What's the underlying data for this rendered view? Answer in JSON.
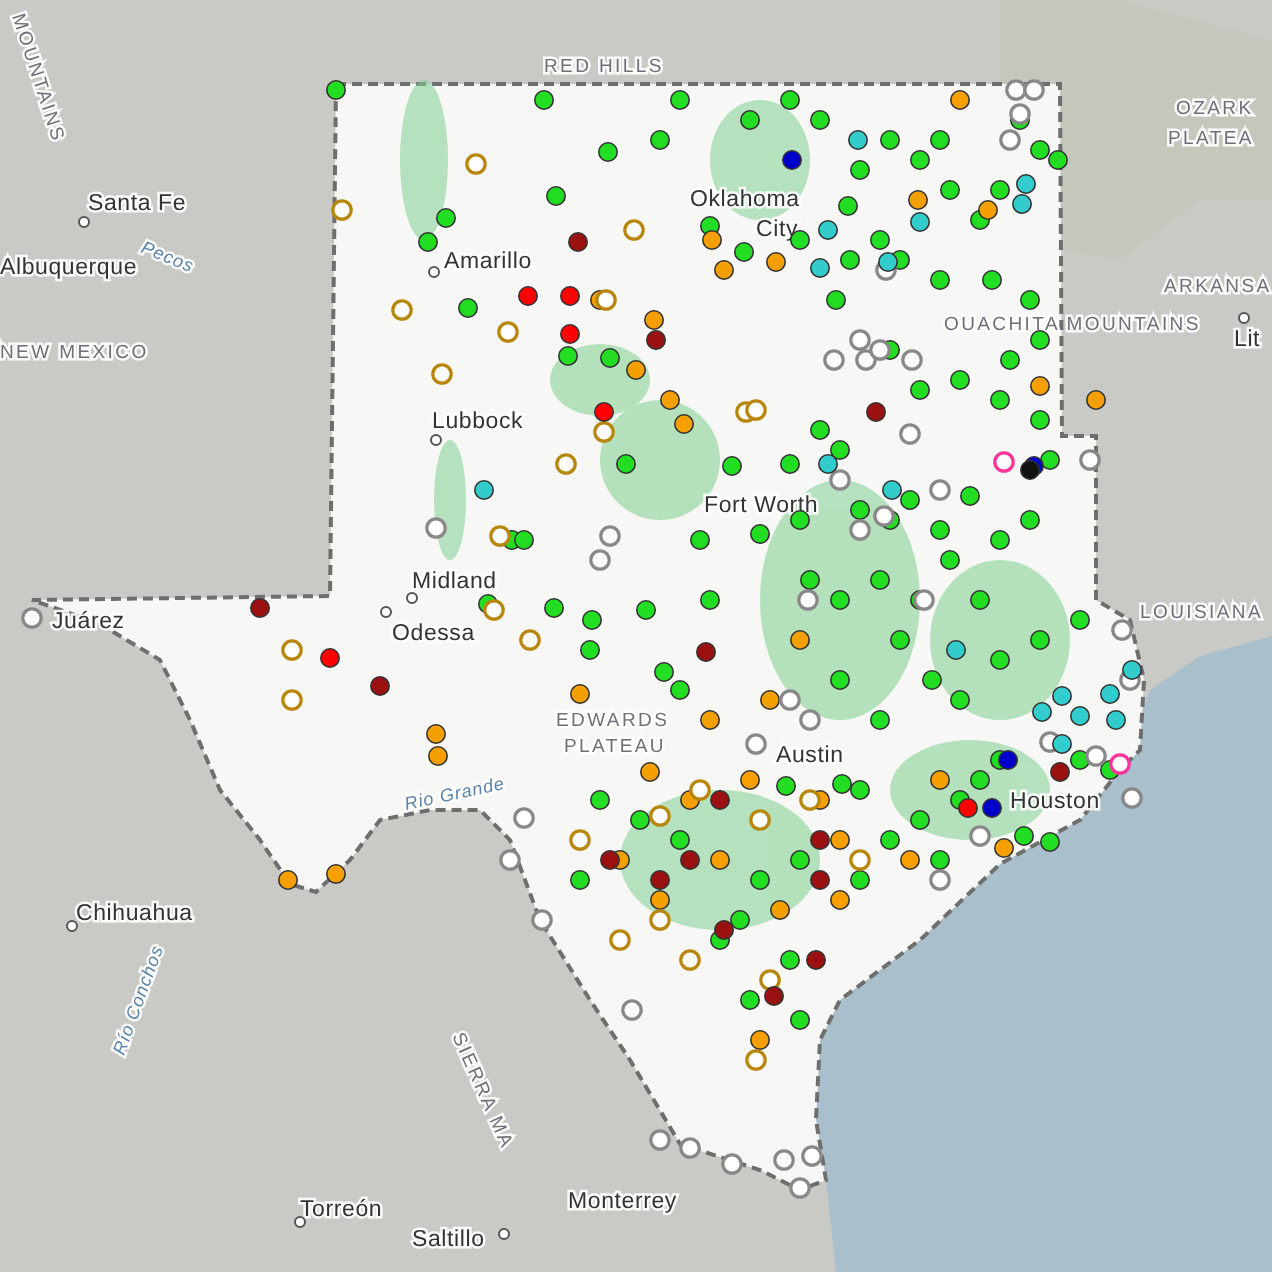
{
  "labels": [
    {
      "text": "MOUNTAINS",
      "kind": "region"
    },
    {
      "text": "RED HILLS",
      "kind": "region"
    },
    {
      "text": "OZARK",
      "kind": "region"
    },
    {
      "text": "PLATEA",
      "kind": "region"
    },
    {
      "text": "ARKANSA",
      "kind": "region"
    },
    {
      "text": "Lit",
      "kind": "city"
    },
    {
      "text": "OUACHITA MOUNTAINS",
      "kind": "region"
    },
    {
      "text": "LOUISIANA",
      "kind": "region"
    },
    {
      "text": "Santa Fe",
      "kind": "city"
    },
    {
      "text": "Albuquerque",
      "kind": "city"
    },
    {
      "text": "NEW MEXICO",
      "kind": "region"
    },
    {
      "text": "Amarillo",
      "kind": "city"
    },
    {
      "text": "Lubbock",
      "kind": "city"
    },
    {
      "text": "Midland",
      "kind": "city"
    },
    {
      "text": "Odessa",
      "kind": "city"
    },
    {
      "text": "Juárez",
      "kind": "city"
    },
    {
      "text": "Chihuahua",
      "kind": "city"
    },
    {
      "text": "Torreón",
      "kind": "city"
    },
    {
      "text": "Saltillo",
      "kind": "city"
    },
    {
      "text": "Monterrey",
      "kind": "city"
    },
    {
      "text": "SIERRA MA",
      "kind": "region"
    },
    {
      "text": "Oklahoma",
      "kind": "city"
    },
    {
      "text": "City",
      "kind": "text"
    },
    {
      "text": "Fort Worth",
      "kind": "city"
    },
    {
      "text": "Austin",
      "kind": "city"
    },
    {
      "text": "Houston",
      "kind": "city"
    },
    {
      "text": "EDWARDS",
      "kind": "region"
    },
    {
      "text": "PLATEAU",
      "kind": "region"
    },
    {
      "text": "Rio Grande",
      "kind": "water"
    },
    {
      "text": "Pecos",
      "kind": "water"
    },
    {
      "text": "Río Conchos",
      "kind": "water"
    }
  ],
  "markers": [
    {
      "kind": "filled",
      "color": "#22dd22"
    },
    {
      "kind": "filled",
      "color": "#22dd22"
    },
    {
      "kind": "filled",
      "color": "#22dd22"
    },
    {
      "kind": "filled",
      "color": "#22dd22"
    },
    {
      "kind": "filled",
      "color": "#22dd22"
    },
    {
      "kind": "filled",
      "color": "#22dd22"
    },
    {
      "kind": "filled",
      "color": "#22dd22"
    },
    {
      "kind": "filled",
      "color": "#22dd22"
    },
    {
      "kind": "filled",
      "color": "#22dd22"
    },
    {
      "kind": "filled",
      "color": "#22dd22"
    },
    {
      "kind": "filled",
      "color": "#22dd22"
    },
    {
      "kind": "filled",
      "color": "#22dd22"
    },
    {
      "kind": "filled",
      "color": "#22dd22"
    },
    {
      "kind": "filled",
      "color": "#22dd22"
    },
    {
      "kind": "filled",
      "color": "#22dd22"
    },
    {
      "kind": "filled",
      "color": "#22dd22"
    },
    {
      "kind": "filled",
      "color": "#22dd22"
    },
    {
      "kind": "filled",
      "color": "#22dd22"
    },
    {
      "kind": "filled",
      "color": "#22dd22"
    },
    {
      "kind": "filled",
      "color": "#22dd22"
    },
    {
      "kind": "filled",
      "color": "#22dd22"
    },
    {
      "kind": "filled",
      "color": "#22dd22"
    },
    {
      "kind": "filled",
      "color": "#22dd22"
    },
    {
      "kind": "filled",
      "color": "#22dd22"
    },
    {
      "kind": "filled",
      "color": "#22dd22"
    },
    {
      "kind": "filled",
      "color": "#22dd22"
    },
    {
      "kind": "filled",
      "color": "#22dd22"
    },
    {
      "kind": "filled",
      "color": "#22dd22"
    },
    {
      "kind": "filled",
      "color": "#22dd22"
    },
    {
      "kind": "filled",
      "color": "#22dd22"
    },
    {
      "kind": "filled",
      "color": "#22dd22"
    },
    {
      "kind": "filled",
      "color": "#22dd22"
    },
    {
      "kind": "filled",
      "color": "#22dd22"
    },
    {
      "kind": "filled",
      "color": "#22dd22"
    },
    {
      "kind": "filled",
      "color": "#22dd22"
    },
    {
      "kind": "filled",
      "color": "#22dd22"
    },
    {
      "kind": "filled",
      "color": "#22dd22"
    },
    {
      "kind": "filled",
      "color": "#22dd22"
    },
    {
      "kind": "filled",
      "color": "#22dd22"
    },
    {
      "kind": "filled",
      "color": "#22dd22"
    },
    {
      "kind": "filled",
      "color": "#22dd22"
    },
    {
      "kind": "filled",
      "color": "#22dd22"
    },
    {
      "kind": "filled",
      "color": "#22dd22"
    },
    {
      "kind": "filled",
      "color": "#22dd22"
    },
    {
      "kind": "filled",
      "color": "#22dd22"
    },
    {
      "kind": "filled",
      "color": "#22dd22"
    },
    {
      "kind": "filled",
      "color": "#22dd22"
    },
    {
      "kind": "filled",
      "color": "#22dd22"
    },
    {
      "kind": "filled",
      "color": "#22dd22"
    },
    {
      "kind": "filled",
      "color": "#22dd22"
    },
    {
      "kind": "filled",
      "color": "#22dd22"
    },
    {
      "kind": "filled",
      "color": "#22dd22"
    },
    {
      "kind": "filled",
      "color": "#22dd22"
    },
    {
      "kind": "filled",
      "color": "#22dd22"
    },
    {
      "kind": "filled",
      "color": "#22dd22"
    },
    {
      "kind": "filled",
      "color": "#22dd22"
    },
    {
      "kind": "filled",
      "color": "#22dd22"
    },
    {
      "kind": "filled",
      "color": "#22dd22"
    },
    {
      "kind": "filled",
      "color": "#22dd22"
    },
    {
      "kind": "filled",
      "color": "#22dd22"
    },
    {
      "kind": "filled",
      "color": "#22dd22"
    },
    {
      "kind": "filled",
      "color": "#22dd22"
    },
    {
      "kind": "filled",
      "color": "#22dd22"
    },
    {
      "kind": "filled",
      "color": "#22dd22"
    },
    {
      "kind": "filled",
      "color": "#22dd22"
    },
    {
      "kind": "filled",
      "color": "#22dd22"
    },
    {
      "kind": "filled",
      "color": "#22dd22"
    },
    {
      "kind": "filled",
      "color": "#22dd22"
    },
    {
      "kind": "filled",
      "color": "#22dd22"
    },
    {
      "kind": "filled",
      "color": "#22dd22"
    },
    {
      "kind": "filled",
      "color": "#22dd22"
    },
    {
      "kind": "filled",
      "color": "#22dd22"
    },
    {
      "kind": "filled",
      "color": "#22dd22"
    },
    {
      "kind": "filled",
      "color": "#22dd22"
    },
    {
      "kind": "filled",
      "color": "#22dd22"
    },
    {
      "kind": "filled",
      "color": "#22dd22"
    },
    {
      "kind": "filled",
      "color": "#22dd22"
    },
    {
      "kind": "filled",
      "color": "#22dd22"
    },
    {
      "kind": "filled",
      "color": "#22dd22"
    },
    {
      "kind": "filled",
      "color": "#22dd22"
    },
    {
      "kind": "filled",
      "color": "#22dd22"
    },
    {
      "kind": "filled",
      "color": "#22dd22"
    },
    {
      "kind": "filled",
      "color": "#22dd22"
    },
    {
      "kind": "filled",
      "color": "#22dd22"
    },
    {
      "kind": "filled",
      "color": "#22dd22"
    },
    {
      "kind": "filled",
      "color": "#22dd22"
    },
    {
      "kind": "filled",
      "color": "#22dd22"
    },
    {
      "kind": "filled",
      "color": "#22dd22"
    },
    {
      "kind": "filled",
      "color": "#22dd22"
    },
    {
      "kind": "filled",
      "color": "#22dd22"
    },
    {
      "kind": "filled",
      "color": "#22dd22"
    },
    {
      "kind": "filled",
      "color": "#22dd22"
    },
    {
      "kind": "filled",
      "color": "#22dd22"
    },
    {
      "kind": "filled",
      "color": "#22dd22"
    },
    {
      "kind": "filled",
      "color": "#22dd22"
    },
    {
      "kind": "filled",
      "color": "#22dd22"
    },
    {
      "kind": "filled",
      "color": "#22dd22"
    },
    {
      "kind": "filled",
      "color": "#22dd22"
    },
    {
      "kind": "filled",
      "color": "#22dd22"
    },
    {
      "kind": "filled",
      "color": "#22dd22"
    },
    {
      "kind": "filled",
      "color": "#22dd22"
    },
    {
      "kind": "filled",
      "color": "#22dd22"
    },
    {
      "kind": "filled",
      "color": "#22dd22"
    },
    {
      "kind": "filled",
      "color": "#22dd22"
    },
    {
      "kind": "filled",
      "color": "#22dd22"
    },
    {
      "kind": "filled",
      "color": "#22dd22"
    },
    {
      "kind": "filled",
      "color": "#22dd22"
    },
    {
      "kind": "filled",
      "color": "#f5a000"
    },
    {
      "kind": "filled",
      "color": "#f5a000"
    },
    {
      "kind": "filled",
      "color": "#f5a000"
    },
    {
      "kind": "filled",
      "color": "#f5a000"
    },
    {
      "kind": "filled",
      "color": "#f5a000"
    },
    {
      "kind": "filled",
      "color": "#f5a000"
    },
    {
      "kind": "filled",
      "color": "#f5a000"
    },
    {
      "kind": "filled",
      "color": "#f5a000"
    },
    {
      "kind": "filled",
      "color": "#f5a000"
    },
    {
      "kind": "filled",
      "color": "#f5a000"
    },
    {
      "kind": "filled",
      "color": "#f5a000"
    },
    {
      "kind": "filled",
      "color": "#f5a000"
    },
    {
      "kind": "filled",
      "color": "#f5a000"
    },
    {
      "kind": "filled",
      "color": "#f5a000"
    },
    {
      "kind": "filled",
      "color": "#f5a000"
    },
    {
      "kind": "filled",
      "color": "#f5a000"
    },
    {
      "kind": "filled",
      "color": "#f5a000"
    },
    {
      "kind": "filled",
      "color": "#f5a000"
    },
    {
      "kind": "filled",
      "color": "#f5a000"
    },
    {
      "kind": "filled",
      "color": "#f5a000"
    },
    {
      "kind": "filled",
      "color": "#f5a000"
    },
    {
      "kind": "filled",
      "color": "#f5a000"
    },
    {
      "kind": "filled",
      "color": "#f5a000"
    },
    {
      "kind": "filled",
      "color": "#f5a000"
    },
    {
      "kind": "filled",
      "color": "#f5a000"
    },
    {
      "kind": "filled",
      "color": "#f5a000"
    },
    {
      "kind": "filled",
      "color": "#f5a000"
    },
    {
      "kind": "filled",
      "color": "#f5a000"
    },
    {
      "kind": "filled",
      "color": "#f5a000"
    },
    {
      "kind": "filled",
      "color": "#f5a000"
    },
    {
      "kind": "filled",
      "color": "#f5a000"
    },
    {
      "kind": "filled",
      "color": "#f5a000"
    },
    {
      "kind": "filled",
      "color": "#f5a000"
    },
    {
      "kind": "filled",
      "color": "#f5a000"
    },
    {
      "kind": "filled",
      "color": "#f5a000"
    },
    {
      "kind": "ring",
      "color": "#b8860b"
    },
    {
      "kind": "ring",
      "color": "#b8860b"
    },
    {
      "kind": "ring",
      "color": "#b8860b"
    },
    {
      "kind": "ring",
      "color": "#b8860b"
    },
    {
      "kind": "ring",
      "color": "#b8860b"
    },
    {
      "kind": "ring",
      "color": "#b8860b"
    },
    {
      "kind": "ring",
      "color": "#b8860b"
    },
    {
      "kind": "ring",
      "color": "#b8860b"
    },
    {
      "kind": "ring",
      "color": "#b8860b"
    },
    {
      "kind": "ring",
      "color": "#b8860b"
    },
    {
      "kind": "ring",
      "color": "#b8860b"
    },
    {
      "kind": "ring",
      "color": "#b8860b"
    },
    {
      "kind": "ring",
      "color": "#b8860b"
    },
    {
      "kind": "ring",
      "color": "#b8860b"
    },
    {
      "kind": "ring",
      "color": "#b8860b"
    },
    {
      "kind": "ring",
      "color": "#b8860b"
    },
    {
      "kind": "ring",
      "color": "#b8860b"
    },
    {
      "kind": "ring",
      "color": "#b8860b"
    },
    {
      "kind": "ring",
      "color": "#b8860b"
    },
    {
      "kind": "ring",
      "color": "#b8860b"
    },
    {
      "kind": "ring",
      "color": "#b8860b"
    },
    {
      "kind": "ring",
      "color": "#b8860b"
    },
    {
      "kind": "ring",
      "color": "#b8860b"
    },
    {
      "kind": "ring",
      "color": "#b8860b"
    },
    {
      "kind": "ring",
      "color": "#b8860b"
    },
    {
      "kind": "ring",
      "color": "#b8860b"
    },
    {
      "kind": "ring",
      "color": "#b8860b"
    },
    {
      "kind": "ring",
      "color": "#888888"
    },
    {
      "kind": "ring",
      "color": "#888888"
    },
    {
      "kind": "ring",
      "color": "#888888"
    },
    {
      "kind": "ring",
      "color": "#888888"
    },
    {
      "kind": "ring",
      "color": "#888888"
    },
    {
      "kind": "ring",
      "color": "#888888"
    },
    {
      "kind": "ring",
      "color": "#888888"
    },
    {
      "kind": "ring",
      "color": "#888888"
    },
    {
      "kind": "ring",
      "color": "#888888"
    },
    {
      "kind": "ring",
      "color": "#888888"
    },
    {
      "kind": "ring",
      "color": "#888888"
    },
    {
      "kind": "ring",
      "color": "#888888"
    },
    {
      "kind": "ring",
      "color": "#888888"
    },
    {
      "kind": "ring",
      "color": "#888888"
    },
    {
      "kind": "ring",
      "color": "#888888"
    },
    {
      "kind": "ring",
      "color": "#888888"
    },
    {
      "kind": "ring",
      "color": "#888888"
    },
    {
      "kind": "ring",
      "color": "#888888"
    },
    {
      "kind": "ring",
      "color": "#888888"
    },
    {
      "kind": "ring",
      "color": "#888888"
    },
    {
      "kind": "ring",
      "color": "#888888"
    },
    {
      "kind": "ring",
      "color": "#888888"
    },
    {
      "kind": "ring",
      "color": "#888888"
    },
    {
      "kind": "ring",
      "color": "#888888"
    },
    {
      "kind": "ring",
      "color": "#888888"
    },
    {
      "kind": "ring",
      "color": "#888888"
    },
    {
      "kind": "ring",
      "color": "#888888"
    },
    {
      "kind": "ring",
      "color": "#888888"
    },
    {
      "kind": "ring",
      "color": "#888888"
    },
    {
      "kind": "ring",
      "color": "#888888"
    },
    {
      "kind": "ring",
      "color": "#888888"
    },
    {
      "kind": "ring",
      "color": "#888888"
    },
    {
      "kind": "ring",
      "color": "#888888"
    },
    {
      "kind": "ring",
      "color": "#888888"
    },
    {
      "kind": "ring",
      "color": "#888888"
    },
    {
      "kind": "ring",
      "color": "#888888"
    },
    {
      "kind": "ring",
      "color": "#888888"
    },
    {
      "kind": "ring",
      "color": "#888888"
    },
    {
      "kind": "ring",
      "color": "#888888"
    },
    {
      "kind": "ring",
      "color": "#888888"
    },
    {
      "kind": "ring",
      "color": "#888888"
    },
    {
      "kind": "ring",
      "color": "#888888"
    },
    {
      "kind": "filled",
      "color": "#9b1111"
    },
    {
      "kind": "filled",
      "color": "#9b1111"
    },
    {
      "kind": "filled",
      "color": "#9b1111"
    },
    {
      "kind": "filled",
      "color": "#9b1111"
    },
    {
      "kind": "filled",
      "color": "#9b1111"
    },
    {
      "kind": "filled",
      "color": "#9b1111"
    },
    {
      "kind": "filled",
      "color": "#9b1111"
    },
    {
      "kind": "filled",
      "color": "#9b1111"
    },
    {
      "kind": "filled",
      "color": "#9b1111"
    },
    {
      "kind": "filled",
      "color": "#9b1111"
    },
    {
      "kind": "filled",
      "color": "#9b1111"
    },
    {
      "kind": "filled",
      "color": "#9b1111"
    },
    {
      "kind": "filled",
      "color": "#9b1111"
    },
    {
      "kind": "filled",
      "color": "#9b1111"
    },
    {
      "kind": "filled",
      "color": "#9b1111"
    },
    {
      "kind": "filled",
      "color": "#9b1111"
    },
    {
      "kind": "filled",
      "color": "#ff0000"
    },
    {
      "kind": "filled",
      "color": "#ff0000"
    },
    {
      "kind": "filled",
      "color": "#ff0000"
    },
    {
      "kind": "filled",
      "color": "#ff0000"
    },
    {
      "kind": "filled",
      "color": "#ff0000"
    },
    {
      "kind": "filled",
      "color": "#ff0000"
    },
    {
      "kind": "filled",
      "color": "#33cccc"
    },
    {
      "kind": "filled",
      "color": "#33cccc"
    },
    {
      "kind": "filled",
      "color": "#33cccc"
    },
    {
      "kind": "filled",
      "color": "#33cccc"
    },
    {
      "kind": "filled",
      "color": "#33cccc"
    },
    {
      "kind": "filled",
      "color": "#33cccc"
    },
    {
      "kind": "filled",
      "color": "#33cccc"
    },
    {
      "kind": "filled",
      "color": "#33cccc"
    },
    {
      "kind": "filled",
      "color": "#33cccc"
    },
    {
      "kind": "filled",
      "color": "#33cccc"
    },
    {
      "kind": "filled",
      "color": "#33cccc"
    },
    {
      "kind": "filled",
      "color": "#33cccc"
    },
    {
      "kind": "filled",
      "color": "#33cccc"
    },
    {
      "kind": "filled",
      "color": "#33cccc"
    },
    {
      "kind": "filled",
      "color": "#33cccc"
    },
    {
      "kind": "filled",
      "color": "#33cccc"
    },
    {
      "kind": "filled",
      "color": "#33cccc"
    },
    {
      "kind": "filled",
      "color": "#33cccc"
    },
    {
      "kind": "filled",
      "color": "#0000cc"
    },
    {
      "kind": "filled",
      "color": "#0000cc"
    },
    {
      "kind": "filled",
      "color": "#0000cc"
    },
    {
      "kind": "filled",
      "color": "#0000cc"
    },
    {
      "kind": "filled",
      "color": "#111111"
    },
    {
      "kind": "ring",
      "color": "#ff3399"
    },
    {
      "kind": "ring",
      "color": "#ff3399"
    }
  ]
}
